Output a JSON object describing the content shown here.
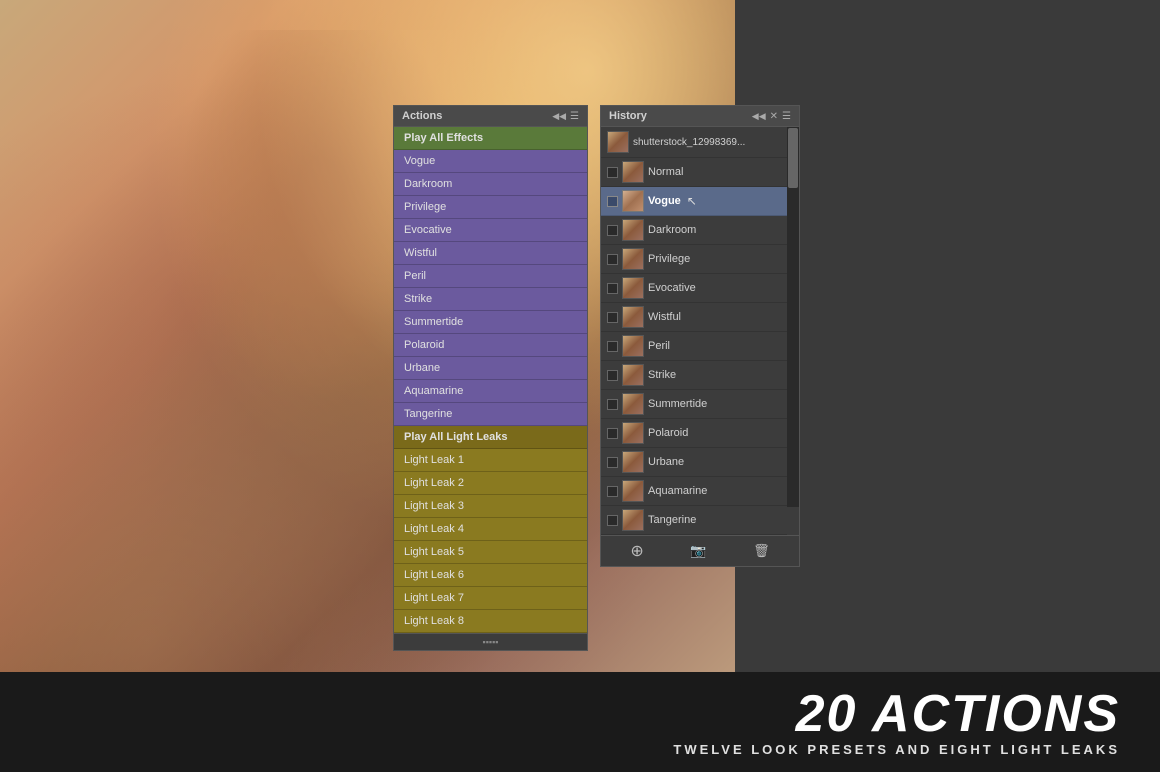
{
  "photo": {
    "alt": "Woman in sweater with warm light leak effect"
  },
  "actions_panel": {
    "title": "Actions",
    "collapse_icon": "◀◀",
    "menu_icon": "☰",
    "items": [
      {
        "label": "Play All Effects",
        "style": "green-header"
      },
      {
        "label": "Vogue",
        "style": "purple"
      },
      {
        "label": "Darkroom",
        "style": "purple"
      },
      {
        "label": "Privilege",
        "style": "purple"
      },
      {
        "label": "Evocative",
        "style": "purple"
      },
      {
        "label": "Wistful",
        "style": "purple"
      },
      {
        "label": "Peril",
        "style": "purple"
      },
      {
        "label": "Strike",
        "style": "purple"
      },
      {
        "label": "Summertide",
        "style": "purple"
      },
      {
        "label": "Polaroid",
        "style": "purple"
      },
      {
        "label": "Urbane",
        "style": "purple"
      },
      {
        "label": "Aquamarine",
        "style": "purple"
      },
      {
        "label": "Tangerine",
        "style": "purple"
      },
      {
        "label": "Play All Light Leaks",
        "style": "gold-header"
      },
      {
        "label": "Light Leak 1",
        "style": "gold"
      },
      {
        "label": "Light Leak 2",
        "style": "gold"
      },
      {
        "label": "Light Leak 3",
        "style": "gold"
      },
      {
        "label": "Light Leak 4",
        "style": "gold"
      },
      {
        "label": "Light Leak 5",
        "style": "gold"
      },
      {
        "label": "Light Leak 6",
        "style": "gold"
      },
      {
        "label": "Light Leak 7",
        "style": "gold"
      },
      {
        "label": "Light Leak 8",
        "style": "gold"
      }
    ],
    "footer": "▪▪▪▪▪"
  },
  "history_panel": {
    "title": "History",
    "collapse_icon": "◀◀",
    "close_icon": "✕",
    "menu_icon": "☰",
    "items": [
      {
        "label": "shutterstock_12998369...",
        "has_checkbox": false,
        "is_top": true
      },
      {
        "label": "Normal",
        "has_checkbox": true
      },
      {
        "label": "Vogue",
        "has_checkbox": true,
        "selected": true
      },
      {
        "label": "Darkroom",
        "has_checkbox": true
      },
      {
        "label": "Privilege",
        "has_checkbox": true
      },
      {
        "label": "Evocative",
        "has_checkbox": true
      },
      {
        "label": "Wistful",
        "has_checkbox": true
      },
      {
        "label": "Peril",
        "has_checkbox": true
      },
      {
        "label": "Strike",
        "has_checkbox": true
      },
      {
        "label": "Summertide",
        "has_checkbox": true
      },
      {
        "label": "Polaroid",
        "has_checkbox": true
      },
      {
        "label": "Urbane",
        "has_checkbox": true
      },
      {
        "label": "Aquamarine",
        "has_checkbox": true
      },
      {
        "label": "Tangerine",
        "has_checkbox": true
      }
    ],
    "footer_buttons": [
      "⊕",
      "📷",
      "🗑"
    ]
  },
  "bottom_bar": {
    "count_label": "20 ACTIONS",
    "subtitle_label": "TWELVE LOOK PRESETS AND EIGHT LIGHT LEAKS"
  },
  "cursor": {
    "visible": true,
    "position": "near Vogue in history"
  }
}
